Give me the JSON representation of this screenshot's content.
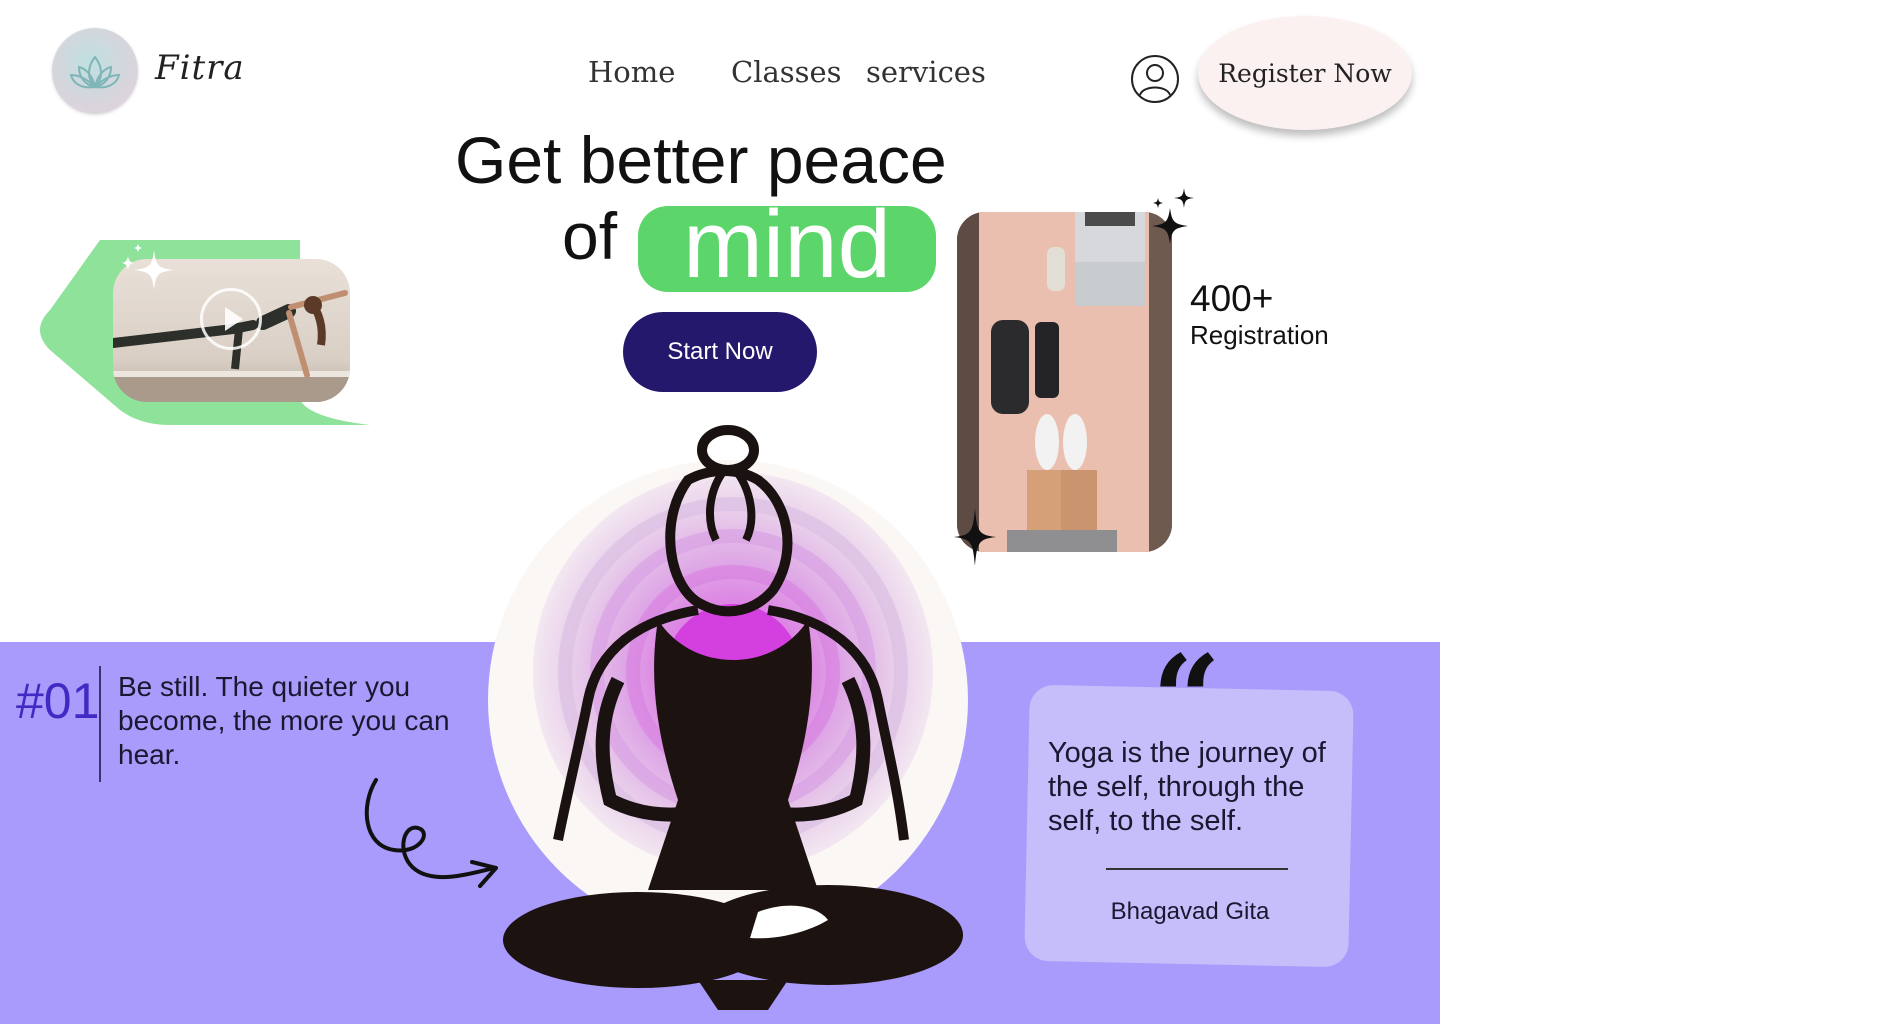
{
  "header": {
    "brand": "Fitra",
    "nav": [
      "Home",
      "Classes",
      "services"
    ],
    "register_label": "Register Now"
  },
  "hero": {
    "line1": "Get better peace",
    "line2_prefix": "of",
    "highlight": "mind",
    "cta_label": "Start Now"
  },
  "stats": {
    "number": "400+",
    "label": "Registration"
  },
  "tip": {
    "number": "#01",
    "text": "Be still. The quieter you become, the more you can hear."
  },
  "quote": {
    "marks": "“",
    "text": "Yoga is the journey of the self, through the self, to the self.",
    "author": "Bhagavad Gita"
  },
  "colors": {
    "accent_green": "#5cd66b",
    "cta_navy": "#24186c",
    "band_purple": "#a99bfb",
    "card_lavender": "#c6befb",
    "number_purple": "#3f2bc4"
  }
}
